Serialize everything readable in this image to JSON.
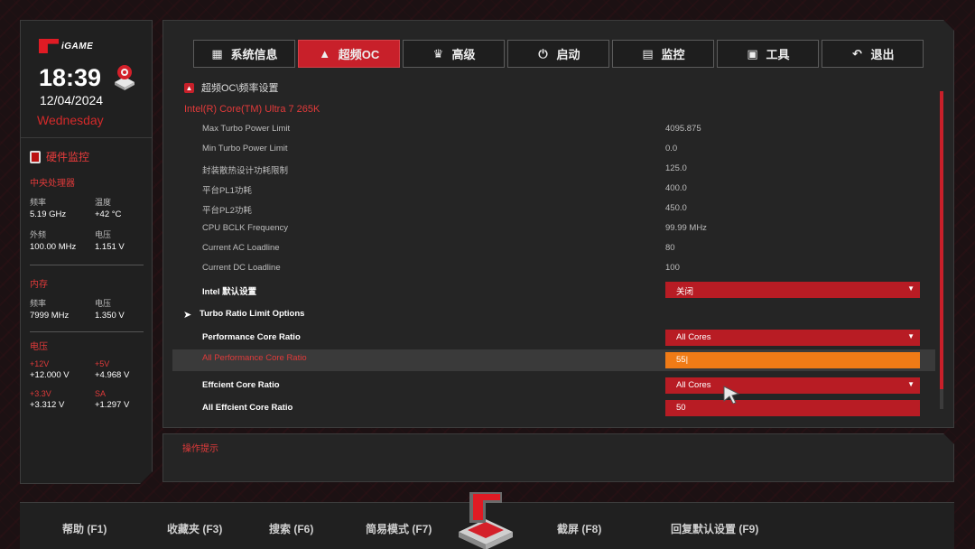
{
  "left_panel": {
    "logo_text": "iGAME",
    "time": "18:39",
    "date": "12/04/2024",
    "day": "Wednesday",
    "hw_title": "硬件监控",
    "cpu": {
      "title": "中央处理器",
      "freq_label": "频率",
      "freq_value": "5.19 GHz",
      "temp_label": "温度",
      "temp_value": "+42 °C",
      "bclk_label": "外频",
      "bclk_value": "100.00 MHz",
      "volt_label": "电压",
      "volt_value": "1.151 V"
    },
    "memory": {
      "title": "内存",
      "freq_label": "频率",
      "freq_value": "7999 MHz",
      "volt_label": "电压",
      "volt_value": "1.350 V"
    },
    "voltage": {
      "title": "电压",
      "v12_label": "+12V",
      "v12_value": "+12.000 V",
      "v5_label": "+5V",
      "v5_value": "+4.968 V",
      "v33_label": "+3.3V",
      "v33_value": "+3.312 V",
      "sa_label": "SA",
      "sa_value": "+1.297 V"
    }
  },
  "tabs": [
    {
      "label": "系统信息",
      "icon": "grid-icon"
    },
    {
      "label": "超频OC",
      "icon": "rocket-icon"
    },
    {
      "label": "高级",
      "icon": "crown-icon"
    },
    {
      "label": "启动",
      "icon": "power-icon"
    },
    {
      "label": "监控",
      "icon": "monitor-icon"
    },
    {
      "label": "工具",
      "icon": "toolbox-icon"
    },
    {
      "label": "退出",
      "icon": "return-icon"
    }
  ],
  "active_tab": "超频OC",
  "content": {
    "breadcrumb": "超频OC\\频率设置",
    "cpu_name": "Intel(R) Core(TM) Ultra 7 265K",
    "rows": [
      {
        "label": "Max Turbo Power Limit",
        "value": "4095.875"
      },
      {
        "label": "Min Turbo Power Limit",
        "value": "0.0"
      },
      {
        "label": "封装散热设计功耗限制",
        "value": "125.0"
      },
      {
        "label": "平台PL1功耗",
        "value": "400.0"
      },
      {
        "label": "平台PL2功耗",
        "value": "450.0"
      },
      {
        "label": "CPU BCLK Frequency",
        "value": "99.99 MHz"
      },
      {
        "label": "Current AC Loadline",
        "value": "80"
      },
      {
        "label": "Current DC Loadline",
        "value": "100"
      }
    ],
    "intel_default": {
      "label": "Intel 默认设置",
      "value": "关闭"
    },
    "turbo_ratio": {
      "label": "Turbo Ratio Limit Options"
    },
    "perf_core_ratio": {
      "label": "Performance Core Ratio",
      "value": "All Cores"
    },
    "all_perf_core_ratio": {
      "label": "All Performance Core Ratio",
      "value": "55"
    },
    "eff_core_ratio": {
      "label": "Effcient Core Ratio",
      "value": "All Cores"
    },
    "all_eff_core_ratio": {
      "label": "All Effcient Core Ratio",
      "value": "50"
    }
  },
  "help": {
    "title": "操作提示"
  },
  "bottom": {
    "help": "帮助 (F1)",
    "favorites": "收藏夹 (F3)",
    "search": "搜索 (F6)",
    "easy_mode": "简易模式 (F7)",
    "screenshot": "截屏 (F8)",
    "defaults": "回复默认设置 (F9)"
  },
  "colors": {
    "accent": "#c8202a",
    "active_input": "#f07b16",
    "panel": "#252525"
  }
}
